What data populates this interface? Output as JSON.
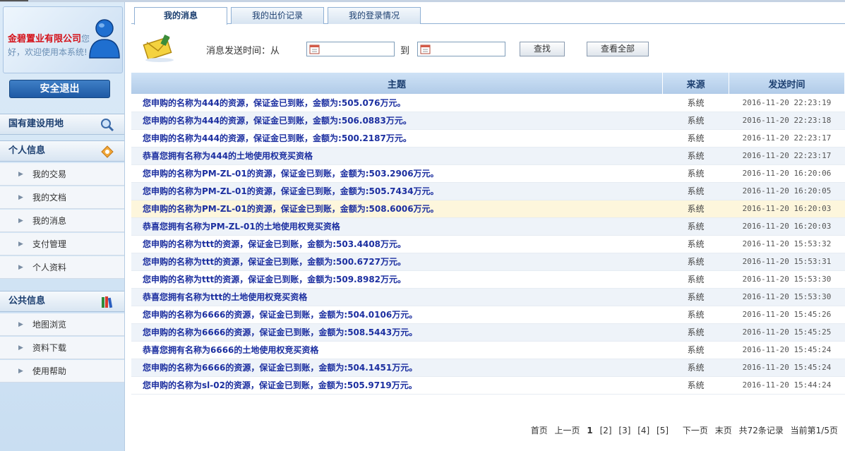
{
  "sidebar": {
    "company_name": "金碧置业有限公司",
    "welcome": "您好，欢迎使用本系统!",
    "logout_label": "安全退出",
    "section_land": "国有建设用地",
    "section_personal": "个人信息",
    "personal_items": [
      {
        "label": "我的交易"
      },
      {
        "label": "我的文档"
      },
      {
        "label": "我的消息"
      },
      {
        "label": "支付管理"
      },
      {
        "label": "个人资料"
      }
    ],
    "section_public": "公共信息",
    "public_items": [
      {
        "label": "地图浏览"
      },
      {
        "label": "资料下载"
      },
      {
        "label": "使用帮助"
      }
    ]
  },
  "tabs": [
    {
      "label": "我的消息"
    },
    {
      "label": "我的出价记录"
    },
    {
      "label": "我的登录情况"
    }
  ],
  "search": {
    "from_label": "消息发送时间：从",
    "to_label": "到",
    "find_label": "查找",
    "view_all_label": "查看全部"
  },
  "table": {
    "headers": {
      "subject": "主题",
      "source": "来源",
      "time": "发送时间"
    },
    "rows": [
      {
        "subject": "您申购的名称为444的资源，保证金已到账，金额为:505.076万元。",
        "source": "系统",
        "time": "2016-11-20 22:23:19"
      },
      {
        "subject": "您申购的名称为444的资源，保证金已到账，金额为:506.0883万元。",
        "source": "系统",
        "time": "2016-11-20 22:23:18"
      },
      {
        "subject": "您申购的名称为444的资源，保证金已到账，金额为:500.2187万元。",
        "source": "系统",
        "time": "2016-11-20 22:23:17"
      },
      {
        "subject": "恭喜您拥有名称为444的土地使用权竞买资格",
        "source": "系统",
        "time": "2016-11-20 22:23:17"
      },
      {
        "subject": "您申购的名称为PM-ZL-01的资源，保证金已到账，金额为:503.2906万元。",
        "source": "系统",
        "time": "2016-11-20 16:20:06"
      },
      {
        "subject": "您申购的名称为PM-ZL-01的资源，保证金已到账，金额为:505.7434万元。",
        "source": "系统",
        "time": "2016-11-20 16:20:05"
      },
      {
        "subject": "您申购的名称为PM-ZL-01的资源，保证金已到账，金额为:508.6006万元。",
        "source": "系统",
        "time": "2016-11-20 16:20:03"
      },
      {
        "subject": "恭喜您拥有名称为PM-ZL-01的土地使用权竞买资格",
        "source": "系统",
        "time": "2016-11-20 16:20:03"
      },
      {
        "subject": "您申购的名称为ttt的资源，保证金已到账，金额为:503.4408万元。",
        "source": "系统",
        "time": "2016-11-20 15:53:32"
      },
      {
        "subject": "您申购的名称为ttt的资源，保证金已到账，金额为:500.6727万元。",
        "source": "系统",
        "time": "2016-11-20 15:53:31"
      },
      {
        "subject": "您申购的名称为ttt的资源，保证金已到账，金额为:509.8982万元。",
        "source": "系统",
        "time": "2016-11-20 15:53:30"
      },
      {
        "subject": "恭喜您拥有名称为ttt的土地使用权竞买资格",
        "source": "系统",
        "time": "2016-11-20 15:53:30"
      },
      {
        "subject": "您申购的名称为6666的资源，保证金已到账，金额为:504.0106万元。",
        "source": "系统",
        "time": "2016-11-20 15:45:26"
      },
      {
        "subject": "您申购的名称为6666的资源，保证金已到账，金额为:508.5443万元。",
        "source": "系统",
        "time": "2016-11-20 15:45:25"
      },
      {
        "subject": "恭喜您拥有名称为6666的土地使用权竞买资格",
        "source": "系统",
        "time": "2016-11-20 15:45:24"
      },
      {
        "subject": "您申购的名称为6666的资源，保证金已到账，金额为:504.1451万元。",
        "source": "系统",
        "time": "2016-11-20 15:45:24"
      },
      {
        "subject": "您申购的名称为sl-02的资源，保证金已到账，金额为:505.9719万元。",
        "source": "系统",
        "time": "2016-11-20 15:44:24"
      }
    ]
  },
  "pager": {
    "first": "首页",
    "prev": "上一页",
    "pages": [
      "1",
      "[2]",
      "[3]",
      "[4]",
      "[5]"
    ],
    "next": "下一页",
    "last": "末页",
    "total": "共72条记录",
    "current": "当前第1/5页"
  }
}
